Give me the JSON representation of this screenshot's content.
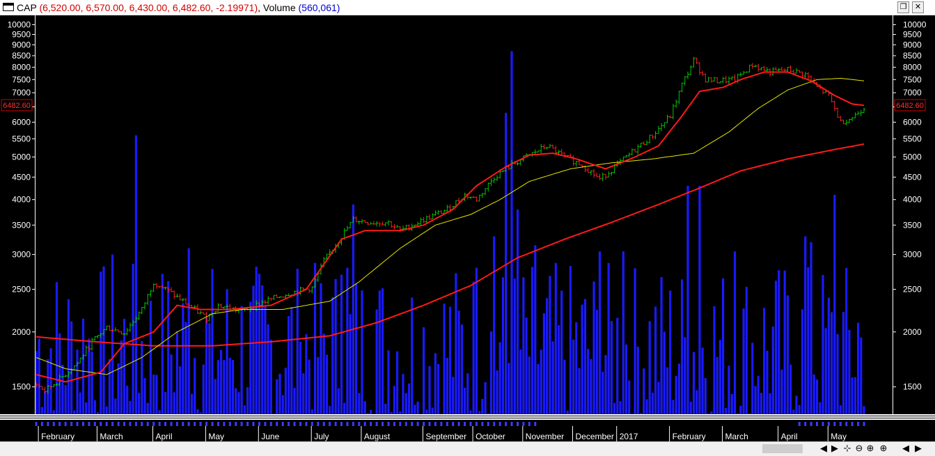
{
  "window": {
    "symbol": "CAP",
    "ohlc_text": "(6,520.00, 6,570.00, 6,430.00, 6,482.60, -2.19971)",
    "volume_label": "Volume",
    "volume_text": "(560,061)",
    "restore_glyph": "❐",
    "close_glyph": "✕"
  },
  "colors": {
    "background": "#000000",
    "price_up": "#00c800",
    "price_down": "#ff2020",
    "ma_fast": "#ff1a1a",
    "ma_mid": "#e6e600",
    "ma_slow": "#ff1a1a",
    "volume": "#1a1aff",
    "axis_text": "#ffffff",
    "last_price_box": "#d40000"
  },
  "chart_data": {
    "type": "line",
    "title": "CAP",
    "y_scale": "log",
    "ylim": [
      1300,
      10500
    ],
    "y_ticks": [
      10000,
      9500,
      9000,
      8500,
      8000,
      7500,
      7000,
      6500,
      6000,
      5500,
      5000,
      4500,
      4000,
      3500,
      3000,
      2500,
      2000,
      1500
    ],
    "y_tick_labels": [
      "10000",
      "9500",
      "9000",
      "8500",
      "8000",
      "7500",
      "7000",
      "6500",
      "6000",
      "5500",
      "5000",
      "4500",
      "4000",
      "3500",
      "3000",
      "2500",
      "2000",
      "1500"
    ],
    "x_labels": [
      "February",
      "March",
      "April",
      "May",
      "June",
      "July",
      "August",
      "September",
      "October",
      "November",
      "December",
      "2017",
      "February",
      "March",
      "April",
      "May"
    ],
    "last_price_label": "6482.60",
    "last_price": 6482.6,
    "price_anchors": [
      [
        0,
        1520
      ],
      [
        3,
        1470
      ],
      [
        8,
        1560
      ],
      [
        14,
        1700
      ],
      [
        19,
        1900
      ],
      [
        24,
        2050
      ],
      [
        30,
        1990
      ],
      [
        36,
        2250
      ],
      [
        40,
        2600
      ],
      [
        46,
        2450
      ],
      [
        52,
        2300
      ],
      [
        58,
        2150
      ],
      [
        62,
        2300
      ],
      [
        70,
        2230
      ],
      [
        78,
        2350
      ],
      [
        86,
        2450
      ],
      [
        94,
        2520
      ],
      [
        98,
        2900
      ],
      [
        104,
        3300
      ],
      [
        108,
        3600
      ],
      [
        114,
        3550
      ],
      [
        120,
        3550
      ],
      [
        124,
        3400
      ],
      [
        132,
        3600
      ],
      [
        140,
        3800
      ],
      [
        146,
        4100
      ],
      [
        150,
        4000
      ],
      [
        156,
        4500
      ],
      [
        162,
        4800
      ],
      [
        168,
        5050
      ],
      [
        174,
        5300
      ],
      [
        180,
        5000
      ],
      [
        186,
        4800
      ],
      [
        192,
        4450
      ],
      [
        198,
        4800
      ],
      [
        204,
        5200
      ],
      [
        210,
        5600
      ],
      [
        216,
        6200
      ],
      [
        220,
        7300
      ],
      [
        224,
        8300
      ],
      [
        228,
        7500
      ],
      [
        232,
        7450
      ],
      [
        238,
        7500
      ],
      [
        244,
        8100
      ],
      [
        250,
        7800
      ],
      [
        256,
        7900
      ],
      [
        262,
        7700
      ],
      [
        266,
        7200
      ],
      [
        270,
        6900
      ],
      [
        274,
        6000
      ],
      [
        278,
        6150
      ],
      [
        282,
        6482.6
      ]
    ],
    "ma_fast_anchors": [
      [
        0,
        1600
      ],
      [
        10,
        1540
      ],
      [
        22,
        1620
      ],
      [
        30,
        1880
      ],
      [
        40,
        2000
      ],
      [
        48,
        2300
      ],
      [
        56,
        2250
      ],
      [
        66,
        2250
      ],
      [
        80,
        2300
      ],
      [
        92,
        2500
      ],
      [
        104,
        3250
      ],
      [
        112,
        3400
      ],
      [
        124,
        3400
      ],
      [
        132,
        3500
      ],
      [
        142,
        3800
      ],
      [
        150,
        4300
      ],
      [
        160,
        4750
      ],
      [
        168,
        5050
      ],
      [
        176,
        5100
      ],
      [
        184,
        4950
      ],
      [
        194,
        4700
      ],
      [
        204,
        5000
      ],
      [
        212,
        5300
      ],
      [
        220,
        6200
      ],
      [
        226,
        7050
      ],
      [
        234,
        7200
      ],
      [
        240,
        7500
      ],
      [
        248,
        7800
      ],
      [
        256,
        7800
      ],
      [
        264,
        7450
      ],
      [
        272,
        6900
      ],
      [
        278,
        6600
      ],
      [
        282,
        6550
      ]
    ],
    "ma_mid_anchors": [
      [
        0,
        1750
      ],
      [
        10,
        1650
      ],
      [
        24,
        1600
      ],
      [
        36,
        1750
      ],
      [
        48,
        2000
      ],
      [
        60,
        2200
      ],
      [
        70,
        2250
      ],
      [
        84,
        2250
      ],
      [
        100,
        2350
      ],
      [
        110,
        2600
      ],
      [
        124,
        3100
      ],
      [
        136,
        3500
      ],
      [
        148,
        3700
      ],
      [
        158,
        4000
      ],
      [
        168,
        4400
      ],
      [
        182,
        4700
      ],
      [
        196,
        4850
      ],
      [
        210,
        4950
      ],
      [
        224,
        5100
      ],
      [
        236,
        5700
      ],
      [
        246,
        6450
      ],
      [
        256,
        7100
      ],
      [
        266,
        7500
      ],
      [
        274,
        7550
      ],
      [
        282,
        7450
      ]
    ],
    "ma_slow_anchors": [
      [
        0,
        1950
      ],
      [
        20,
        1900
      ],
      [
        40,
        1860
      ],
      [
        60,
        1860
      ],
      [
        80,
        1900
      ],
      [
        100,
        1960
      ],
      [
        116,
        2100
      ],
      [
        132,
        2300
      ],
      [
        148,
        2550
      ],
      [
        164,
        2950
      ],
      [
        180,
        3250
      ],
      [
        196,
        3550
      ],
      [
        212,
        3900
      ],
      [
        226,
        4250
      ],
      [
        240,
        4650
      ],
      [
        256,
        4950
      ],
      [
        272,
        5200
      ],
      [
        282,
        5350
      ]
    ],
    "volume_range": [
      1300,
      4200
    ],
    "volume_spikes": [
      [
        26,
        3000
      ],
      [
        34,
        5600
      ],
      [
        52,
        3100
      ],
      [
        90,
        1900
      ],
      [
        104,
        2700
      ],
      [
        106,
        2800
      ],
      [
        108,
        3900
      ],
      [
        116,
        2250
      ],
      [
        150,
        2800
      ],
      [
        156,
        3300
      ],
      [
        160,
        6300
      ],
      [
        162,
        8700
      ],
      [
        164,
        3800
      ],
      [
        170,
        3150
      ],
      [
        192,
        3050
      ],
      [
        200,
        3050
      ],
      [
        222,
        4300
      ],
      [
        226,
        4300
      ],
      [
        238,
        3050
      ],
      [
        262,
        3300
      ],
      [
        264,
        3200
      ],
      [
        272,
        4100
      ],
      [
        280,
        2100
      ]
    ]
  },
  "bottom_bar": {
    "controls": [
      "◀",
      "▶",
      "⊹",
      "⊖",
      "⊕",
      "◀",
      "▶"
    ]
  }
}
